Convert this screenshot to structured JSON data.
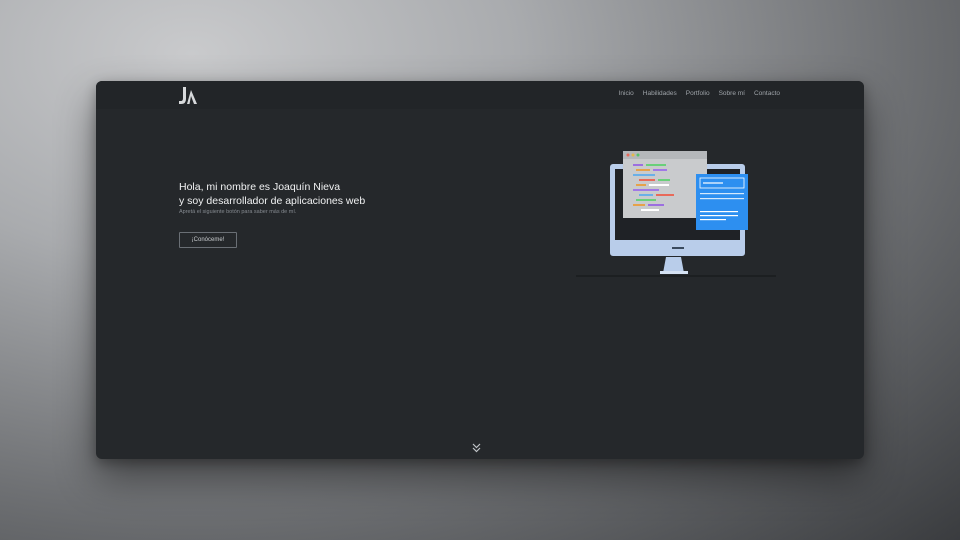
{
  "header": {
    "logo_text": "JN",
    "nav": [
      "Inicio",
      "Habilidades",
      "Portfolio",
      "Sobre mí",
      "Contacto"
    ]
  },
  "hero": {
    "title_line1": "Hola, mi nombre es Joaquín Nieva",
    "title_line2": "y soy desarrollador de aplicaciones web",
    "subtitle": "Apretá el siguiente botón para saber más de mí.",
    "cta_label": "¡Conóceme!"
  },
  "icons": {
    "logo": "jn-logo-icon",
    "illustration": "computer-code-illustration",
    "scroll": "double-chevron-down-icon"
  },
  "colors": {
    "page_bg": "#25282b",
    "nav_text": "#9ea3a8",
    "accent_blue": "#2d8ff0",
    "monitor": "#b9cdea"
  }
}
